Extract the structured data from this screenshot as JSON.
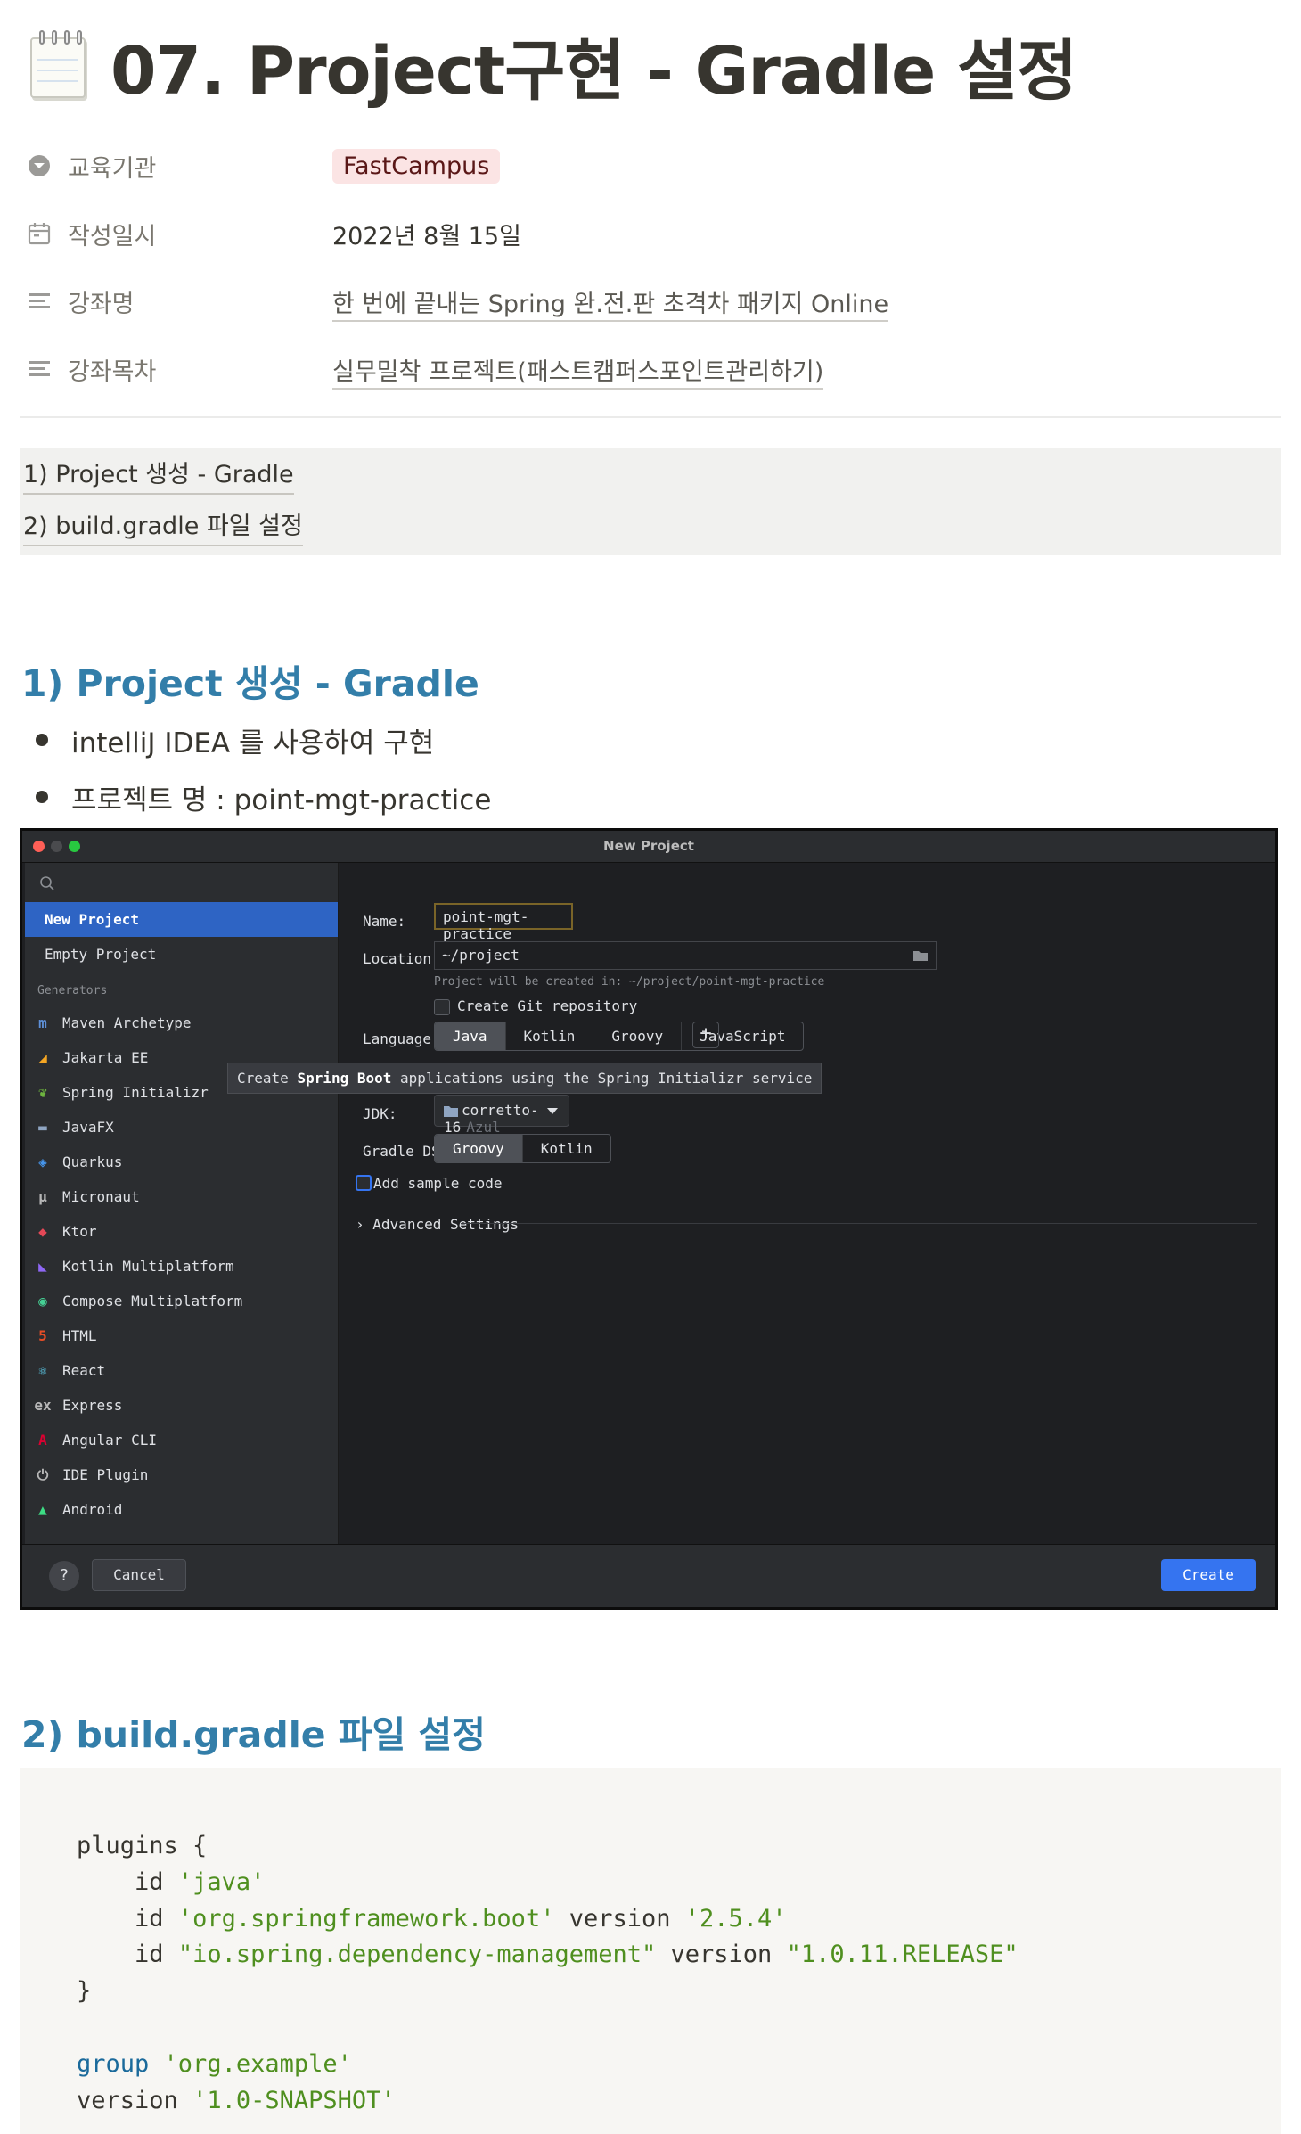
{
  "page": {
    "title": "07. Project구현 - Gradle 설정",
    "properties": [
      {
        "key": "교육기관",
        "icon": "select-icon",
        "value": "FastCampus",
        "type": "tag"
      },
      {
        "key": "작성일시",
        "icon": "calendar-icon",
        "value": "2022년 8월 15일",
        "type": "date"
      },
      {
        "key": "강좌명",
        "icon": "text-icon",
        "value": "한 번에 끝내는 Spring 완.전.판 초격차 패키지 Online",
        "type": "link"
      },
      {
        "key": "강좌목차",
        "icon": "text-icon",
        "value": "실무밀착 프로젝트(패스트캠퍼스포인트관리하기)",
        "type": "link"
      }
    ],
    "toc": [
      "1) Project 생성 - Gradle",
      "2) build.gradle 파일 설정"
    ]
  },
  "section1": {
    "heading": "1) Project 생성 - Gradle",
    "bullets": [
      "intelliJ IDEA 를 사용하여 구현",
      "프로젝트 명 : point-mgt-practice"
    ]
  },
  "ide": {
    "window_title": "New Project",
    "sidebar": {
      "top_items": [
        "New Project",
        "Empty Project"
      ],
      "generators_label": "Generators",
      "generators": [
        {
          "label": "Maven Archetype",
          "icon": "maven-icon",
          "color": "#5d8fd6"
        },
        {
          "label": "Jakarta EE",
          "icon": "jakarta-icon",
          "color": "#f5a623"
        },
        {
          "label": "Spring Initializr",
          "icon": "spring-icon",
          "color": "#6db33f"
        },
        {
          "label": "JavaFX",
          "icon": "folder-icon",
          "color": "#8fa5c2"
        },
        {
          "label": "Quarkus",
          "icon": "quarkus-icon",
          "color": "#4695eb"
        },
        {
          "label": "Micronaut",
          "icon": "micronaut-icon",
          "color": "#b7b7b7"
        },
        {
          "label": "Ktor",
          "icon": "ktor-icon",
          "color": "#e44857"
        },
        {
          "label": "Kotlin Multiplatform",
          "icon": "kotlin-icon",
          "color": "#8f67f5"
        },
        {
          "label": "Compose Multiplatform",
          "icon": "compose-icon",
          "color": "#45d094"
        },
        {
          "label": "HTML",
          "icon": "html5-icon",
          "color": "#e44d26"
        },
        {
          "label": "React",
          "icon": "react-icon",
          "color": "#61dafb"
        },
        {
          "label": "Express",
          "icon": "express-icon",
          "color": "#b7b7b7"
        },
        {
          "label": "Angular CLI",
          "icon": "angular-icon",
          "color": "#dd0031"
        },
        {
          "label": "IDE Plugin",
          "icon": "plugin-icon",
          "color": "#b7b7b7"
        },
        {
          "label": "Android",
          "icon": "android-icon",
          "color": "#3ddc84"
        }
      ]
    },
    "form": {
      "name_label": "Name:",
      "name_value": "point-mgt-practice",
      "location_label": "Location:",
      "location_value": "~/project",
      "location_hint": "Project will be created in: ~/project/point-mgt-practice",
      "git_label": "Create Git repository",
      "language_label": "Language:",
      "languages": [
        "Java",
        "Kotlin",
        "Groovy",
        "JavaScript"
      ],
      "language_selected": "Java",
      "tooltip_pre": "Create ",
      "tooltip_bold": "Spring Boot",
      "tooltip_post": " applications using the Spring Initializr service",
      "jdk_label": "JDK:",
      "jdk_value": "corretto-16",
      "jdk_vendor": "Azul",
      "dsl_label": "Gradle DSL:",
      "dsl_options": [
        "Groovy",
        "Kotlin"
      ],
      "dsl_selected": "Groovy",
      "sample_code_label": "Add sample code",
      "advanced_label": "Advanced Settings"
    },
    "footer": {
      "help": "?",
      "cancel": "Cancel",
      "create": "Create"
    },
    "accent": "#3574f0"
  },
  "section2": {
    "heading": "2) build.gradle 파일 설정",
    "code": {
      "plugins_open": "plugins {",
      "id_kw": "id",
      "version_kw": "version",
      "p1_id": "'java'",
      "p2_id": "'org.springframework.boot'",
      "p2_ver": "'2.5.4'",
      "p3_id": "\"io.spring.dependency-management\"",
      "p3_ver": "\"1.0.11.RELEASE\"",
      "plugins_close": "}",
      "group_kw": "group",
      "group_val": "'org.example'",
      "version_val": "'1.0-SNAPSHOT'"
    }
  }
}
